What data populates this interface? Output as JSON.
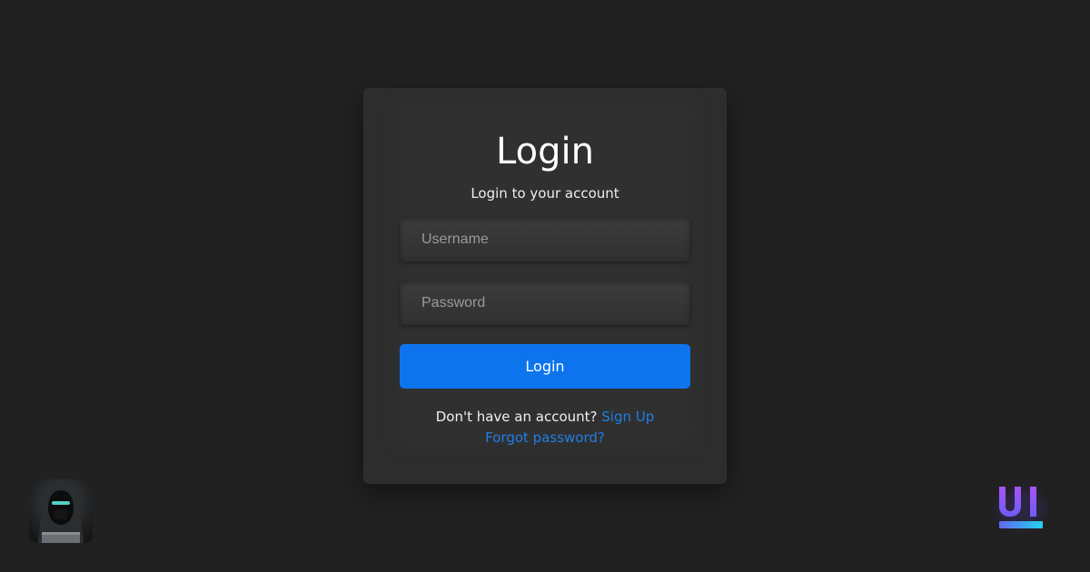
{
  "login": {
    "title": "Login",
    "subtitle": "Login to your account",
    "username_placeholder": "Username",
    "password_placeholder": "Password",
    "button_label": "Login",
    "no_account_text": "Don't have an account?",
    "signup_link": "Sign Up",
    "forgot_link": "Forgot password?"
  },
  "colors": {
    "background": "#212121",
    "card": "#2d2d2d",
    "accent": "#0d74ee",
    "link": "#1f7fe6"
  },
  "icons": {
    "avatar": "hooded-hacker-avatar",
    "logo": "ui-logo"
  }
}
